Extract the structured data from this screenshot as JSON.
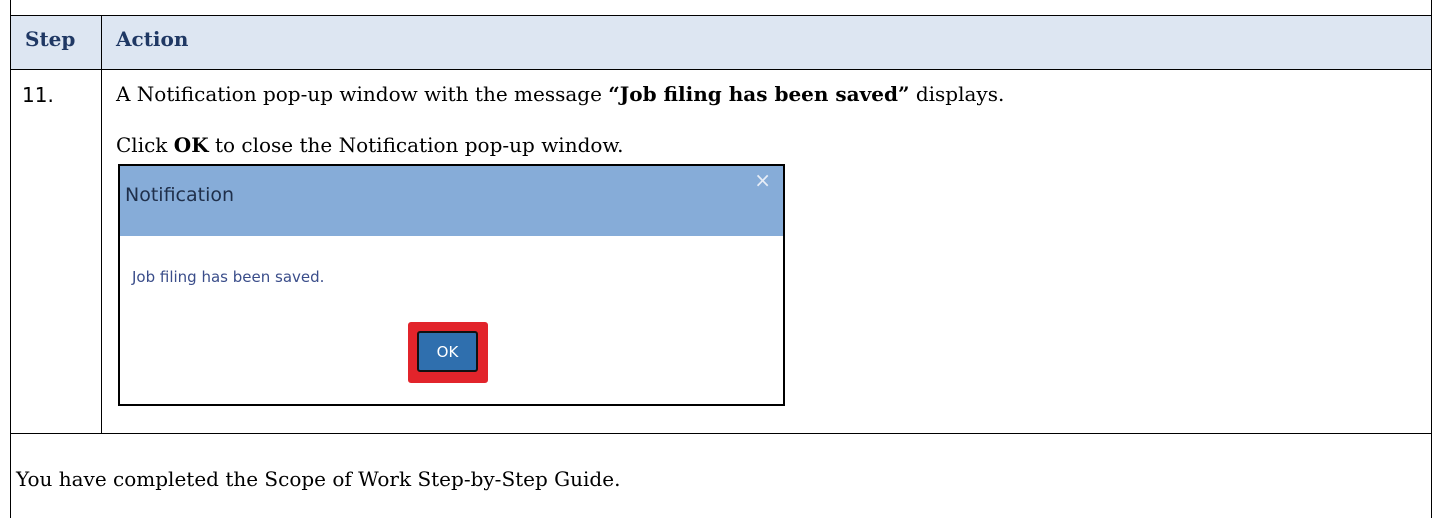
{
  "table": {
    "header": {
      "step": "Step",
      "action": "Action"
    },
    "row": {
      "step_number": "11.",
      "line1": {
        "prefix": "A Notification pop-up window with the message ",
        "bold": "“Job filing has been saved”",
        "suffix": " displays."
      },
      "line2": {
        "prefix": "Click ",
        "bold": "OK",
        "suffix": " to close the Notification pop-up window."
      }
    },
    "footer": "You have completed the Scope of Work Step-by-Step Guide."
  },
  "dialog": {
    "title": "Notification",
    "close_glyph": "×",
    "message": "Job filing has been saved.",
    "ok_label": "OK"
  },
  "colors": {
    "header_bg": "#dde6f2",
    "header_text": "#1f3864",
    "dialog_titlebar": "#86acd8",
    "ok_button": "#2f6fae",
    "highlight": "#e2242b"
  }
}
